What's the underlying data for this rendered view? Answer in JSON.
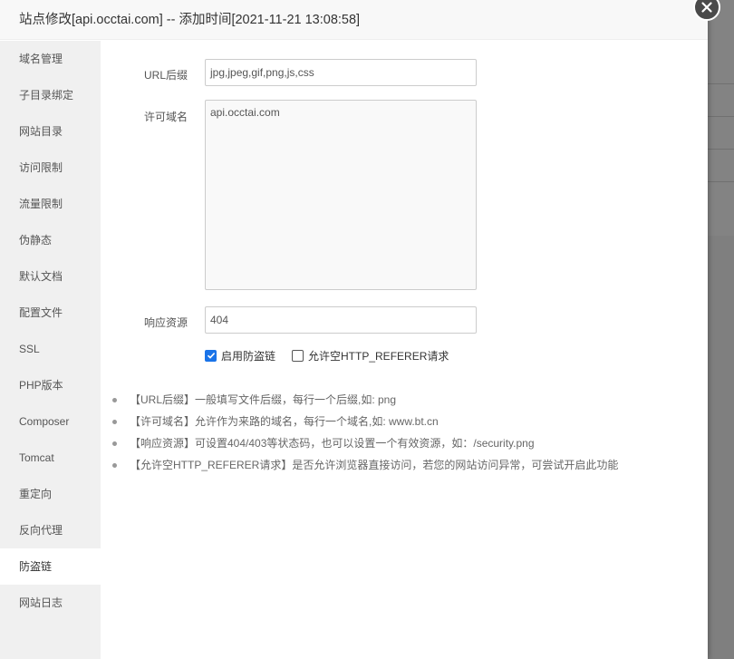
{
  "dialog": {
    "title": "站点修改[api.occtai.com] -- 添加时间[2021-11-21 13:08:58]"
  },
  "sidebar": {
    "items": [
      {
        "label": "域名管理"
      },
      {
        "label": "子目录绑定"
      },
      {
        "label": "网站目录"
      },
      {
        "label": "访问限制"
      },
      {
        "label": "流量限制"
      },
      {
        "label": "伪静态"
      },
      {
        "label": "默认文档"
      },
      {
        "label": "配置文件"
      },
      {
        "label": "SSL"
      },
      {
        "label": "PHP版本"
      },
      {
        "label": "Composer"
      },
      {
        "label": "Tomcat"
      },
      {
        "label": "重定向"
      },
      {
        "label": "反向代理"
      },
      {
        "label": "防盗链",
        "active": true
      },
      {
        "label": "网站日志"
      }
    ]
  },
  "form": {
    "url_suffix": {
      "label": "URL后缀",
      "value": "jpg,jpeg,gif,png,js,css"
    },
    "allowed_domains": {
      "label": "许可域名",
      "value": "api.occtai.com"
    },
    "response_resource": {
      "label": "响应资源",
      "value": "404"
    },
    "enable_hotlink": {
      "label": "启用防盗链",
      "checked": true
    },
    "allow_empty_referer": {
      "label": "允许空HTTP_REFERER请求",
      "checked": false
    }
  },
  "help": [
    "【URL后缀】一般填写文件后缀，每行一个后缀,如: png",
    "【许可域名】允许作为来路的域名，每行一个域名,如: www.bt.cn",
    "【响应资源】可设置404/403等状态码，也可以设置一个有效资源，如：/security.png",
    "【允许空HTTP_REFERER请求】是否允许浏览器直接访问，若您的网站访问异常，可尝试开启此功能"
  ],
  "colors": {
    "accent": "#1a73e8",
    "close_button": "#4a4a4a",
    "sidebar_bg": "#f0f0f0"
  },
  "icons": {
    "close": "close-icon",
    "checkmark": "checkmark-icon"
  }
}
